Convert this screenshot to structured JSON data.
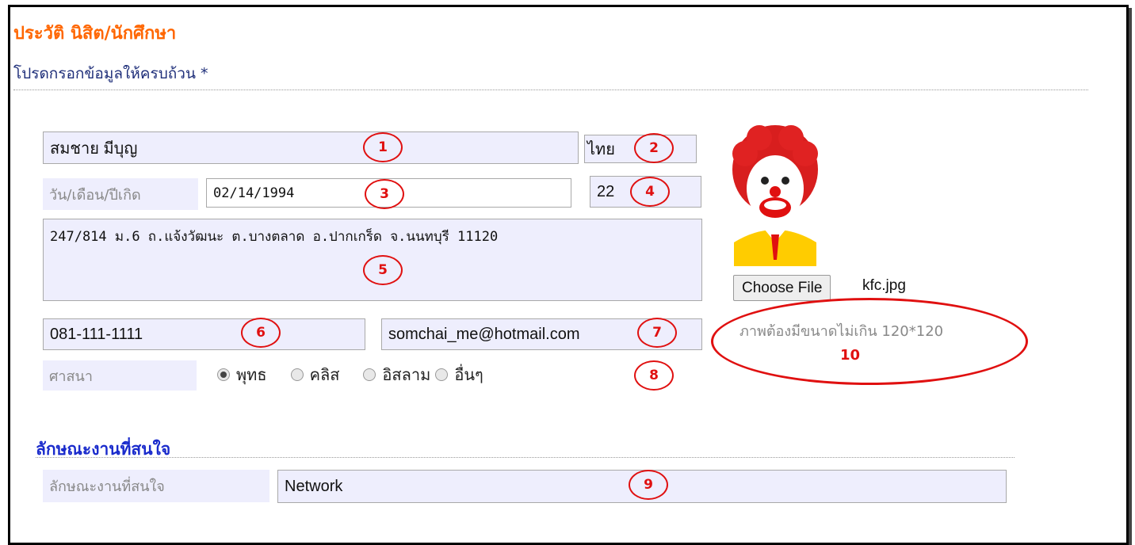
{
  "page": {
    "title": "ประวัติ นิสิต/นักศึกษา",
    "subtitle": "โปรดกรอกข้อมูลให้ครบถ้วน *"
  },
  "form": {
    "full_name": "สมชาย มีบุญ",
    "nationality": "ไทย",
    "dob_label": "วัน/เดือน/ปีเกิด",
    "dob": "02/14/1994",
    "age": "22",
    "address": "247/814 ม.6 ถ.แจ้งวัฒนะ ต.บางตลาด อ.ปากเกร็ด จ.นนทบุรี 11120",
    "phone": "081-111-1111",
    "email": "somchai_me@hotmail.com",
    "religion_label": "ศาสนา",
    "religion_options": [
      "พุทธ",
      "คลิส",
      "อิสลาม",
      "อื่นๆ"
    ],
    "religion_selected": "พุทธ"
  },
  "photo": {
    "choose_button": "Choose File",
    "file_name": "kfc.jpg",
    "size_note": "ภาพต้องมีขนาดไม่เกิน 120*120"
  },
  "jobs": {
    "section_title": "ลักษณะงานที่สนใจ",
    "label": "ลักษณะงานที่สนใจ",
    "value": "Network"
  },
  "annotations": [
    "1",
    "2",
    "3",
    "4",
    "5",
    "6",
    "7",
    "8",
    "9",
    "10"
  ],
  "colors": {
    "title": "#ff6600",
    "subtitle": "#1f2f7a",
    "section": "#1a2bcc",
    "field_bg": "#eeeefd",
    "annotation": "#e01010"
  }
}
